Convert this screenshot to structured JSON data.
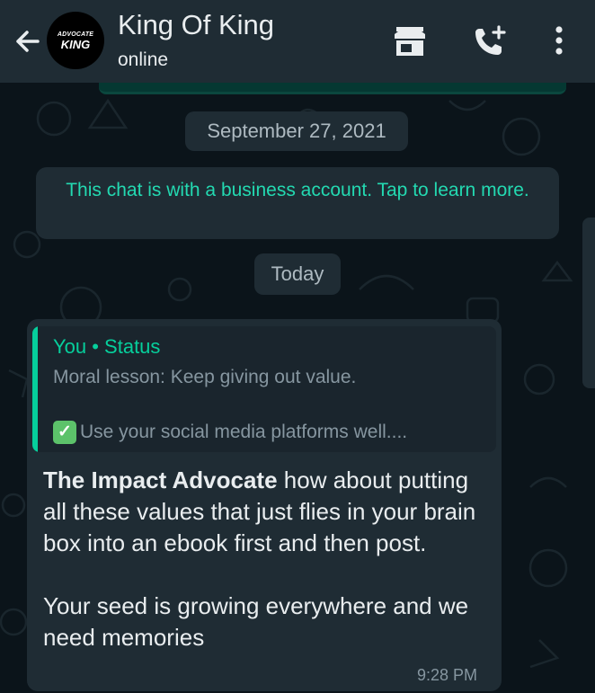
{
  "header": {
    "title": "King Of King",
    "status": "online",
    "avatar_line1": "ADVOCATE",
    "avatar_line2": "KING",
    "icons": [
      "back-arrow-icon",
      "store-icon",
      "call-add-icon",
      "more-vert-icon"
    ]
  },
  "chat": {
    "date_chip": "September 27, 2021",
    "business_notice": "This chat is with a business account. Tap to learn more.",
    "today_chip": "Today",
    "message": {
      "quote_author": "You • Status",
      "quote_line1": "Moral lesson: Keep giving out value.",
      "quote_line2": "Use your social media platforms well....",
      "sender_bold": "The Impact Advocate",
      "text_part1": " how about putting all these values that just flies in your brain box into an ebook first and then post.",
      "text_part2": "Your seed is growing everywhere and we need memories",
      "time": "9:28 PM"
    }
  },
  "colors": {
    "header_bg": "#1f2c34",
    "chat_bg": "#0b141a",
    "accent": "#06cf9c",
    "notice_text": "#23d9b1",
    "text": "#e9edef",
    "muted": "#8696a0"
  }
}
